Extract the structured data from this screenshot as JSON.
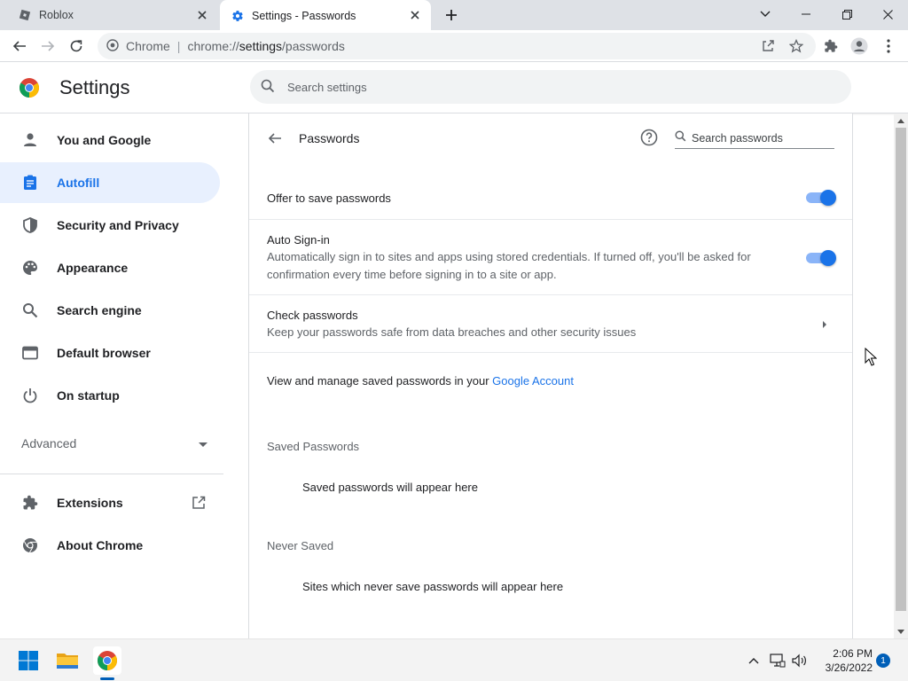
{
  "colors": {
    "accent": "#1a73e8",
    "selected_nav_bg": "#e8f0fe",
    "toggle_track": "#8ab4f8",
    "tabstrip_bg": "#dee1e6",
    "taskbar_bg": "#f3f3f3"
  },
  "tabs": [
    {
      "title": "Roblox",
      "icon": "roblox-icon",
      "active": false
    },
    {
      "title": "Settings - Passwords",
      "icon": "gear-icon",
      "active": true
    }
  ],
  "omnibox": {
    "site_chip": "Chrome",
    "url_prefix": "chrome://",
    "url_host": "settings",
    "url_path": "/passwords"
  },
  "settings_header": {
    "title": "Settings",
    "search_placeholder": "Search settings"
  },
  "sidebar": {
    "items": [
      {
        "label": "You and Google",
        "icon": "person-icon",
        "selected": false
      },
      {
        "label": "Autofill",
        "icon": "clipboard-icon",
        "selected": true
      },
      {
        "label": "Security and Privacy",
        "icon": "shield-icon",
        "selected": false
      },
      {
        "label": "Appearance",
        "icon": "palette-icon",
        "selected": false
      },
      {
        "label": "Search engine",
        "icon": "search-icon",
        "selected": false
      },
      {
        "label": "Default browser",
        "icon": "browser-icon",
        "selected": false
      },
      {
        "label": "On startup",
        "icon": "power-icon",
        "selected": false
      }
    ],
    "advanced_label": "Advanced",
    "extensions_label": "Extensions",
    "about_label": "About Chrome"
  },
  "passwords_page": {
    "title": "Passwords",
    "search_placeholder": "Search passwords",
    "offer_to_save": {
      "label": "Offer to save passwords",
      "enabled": true
    },
    "auto_signin": {
      "label": "Auto Sign-in",
      "description": "Automatically sign in to sites and apps using stored credentials. If turned off, you'll be asked for confirmation every time before signing in to a site or app.",
      "enabled": true
    },
    "check_passwords": {
      "label": "Check passwords",
      "description": "Keep your passwords safe from data breaches and other security issues"
    },
    "manage_text": "View and manage saved passwords in your",
    "manage_link": "Google Account",
    "saved_heading": "Saved Passwords",
    "saved_empty": "Saved passwords will appear here",
    "never_heading": "Never Saved",
    "never_empty": "Sites which never save passwords will appear here"
  },
  "taskbar": {
    "time": "2:06 PM",
    "date": "3/26/2022",
    "notification_count": "1"
  }
}
